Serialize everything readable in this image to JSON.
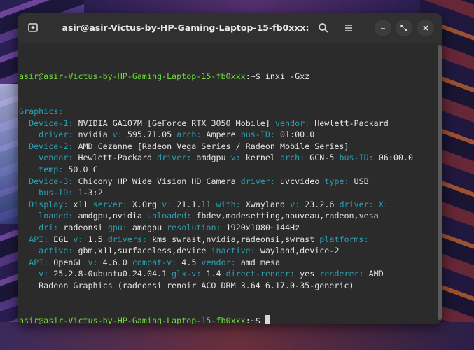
{
  "window": {
    "title": "asir@asir-Victus-by-HP-Gaming-Laptop-15-fb0xxx: ~"
  },
  "icons": {
    "new_tab": "new-tab-icon",
    "search": "search-icon",
    "menu": "hamburger-menu-icon",
    "minimize": "minimize-icon",
    "maximize": "maximize-icon",
    "close": "close-icon"
  },
  "colors": {
    "prompt_user": "#6fdc3a",
    "key": "#2aa1b3",
    "value": "#e4e4e4",
    "background": "#2b2b2b"
  },
  "terminal": {
    "prompt_user": "asir@asir-Victus-by-HP-Gaming-Laptop-15-fb0xxx",
    "prompt_path": ":~$",
    "command": " inxi -Gxz",
    "output": [
      [
        {
          "t": "k",
          "s": "Graphics:"
        }
      ],
      [
        {
          "t": "v",
          "s": "  "
        },
        {
          "t": "k",
          "s": "Device-1:"
        },
        {
          "t": "v",
          "s": " NVIDIA GA107M [GeForce RTX 3050 Mobile] "
        },
        {
          "t": "k",
          "s": "vendor:"
        },
        {
          "t": "v",
          "s": " Hewlett-Packard"
        }
      ],
      [
        {
          "t": "v",
          "s": "    "
        },
        {
          "t": "k",
          "s": "driver:"
        },
        {
          "t": "v",
          "s": " nvidia "
        },
        {
          "t": "k",
          "s": "v:"
        },
        {
          "t": "v",
          "s": " 595.71.05 "
        },
        {
          "t": "k",
          "s": "arch:"
        },
        {
          "t": "v",
          "s": " Ampere "
        },
        {
          "t": "k",
          "s": "bus-ID:"
        },
        {
          "t": "v",
          "s": " 01:00.0"
        }
      ],
      [
        {
          "t": "v",
          "s": "  "
        },
        {
          "t": "k",
          "s": "Device-2:"
        },
        {
          "t": "v",
          "s": " AMD Cezanne [Radeon Vega Series / Radeon Mobile Series]"
        }
      ],
      [
        {
          "t": "v",
          "s": "    "
        },
        {
          "t": "k",
          "s": "vendor:"
        },
        {
          "t": "v",
          "s": " Hewlett-Packard "
        },
        {
          "t": "k",
          "s": "driver:"
        },
        {
          "t": "v",
          "s": " amdgpu "
        },
        {
          "t": "k",
          "s": "v:"
        },
        {
          "t": "v",
          "s": " kernel "
        },
        {
          "t": "k",
          "s": "arch:"
        },
        {
          "t": "v",
          "s": " GCN-5 "
        },
        {
          "t": "k",
          "s": "bus-ID:"
        },
        {
          "t": "v",
          "s": " 06:00.0"
        }
      ],
      [
        {
          "t": "v",
          "s": "    "
        },
        {
          "t": "k",
          "s": "temp:"
        },
        {
          "t": "v",
          "s": " 50.0 C"
        }
      ],
      [
        {
          "t": "v",
          "s": "  "
        },
        {
          "t": "k",
          "s": "Device-3:"
        },
        {
          "t": "v",
          "s": " Chicony HP Wide Vision HD Camera "
        },
        {
          "t": "k",
          "s": "driver:"
        },
        {
          "t": "v",
          "s": " uvcvideo "
        },
        {
          "t": "k",
          "s": "type:"
        },
        {
          "t": "v",
          "s": " USB"
        }
      ],
      [
        {
          "t": "v",
          "s": "    "
        },
        {
          "t": "k",
          "s": "bus-ID:"
        },
        {
          "t": "v",
          "s": " 1-3:2"
        }
      ],
      [
        {
          "t": "v",
          "s": "  "
        },
        {
          "t": "k",
          "s": "Display:"
        },
        {
          "t": "v",
          "s": " x11 "
        },
        {
          "t": "k",
          "s": "server:"
        },
        {
          "t": "v",
          "s": " X.Org "
        },
        {
          "t": "k",
          "s": "v:"
        },
        {
          "t": "v",
          "s": " 21.1.11 "
        },
        {
          "t": "k",
          "s": "with:"
        },
        {
          "t": "v",
          "s": " Xwayland "
        },
        {
          "t": "k",
          "s": "v:"
        },
        {
          "t": "v",
          "s": " 23.2.6 "
        },
        {
          "t": "k",
          "s": "driver:"
        },
        {
          "t": "v",
          "s": " "
        },
        {
          "t": "k",
          "s": "X:"
        }
      ],
      [
        {
          "t": "v",
          "s": "    "
        },
        {
          "t": "k",
          "s": "loaded:"
        },
        {
          "t": "v",
          "s": " amdgpu,nvidia "
        },
        {
          "t": "k",
          "s": "unloaded:"
        },
        {
          "t": "v",
          "s": " fbdev,modesetting,nouveau,radeon,vesa"
        }
      ],
      [
        {
          "t": "v",
          "s": "    "
        },
        {
          "t": "k",
          "s": "dri:"
        },
        {
          "t": "v",
          "s": " radeonsi "
        },
        {
          "t": "k",
          "s": "gpu:"
        },
        {
          "t": "v",
          "s": " amdgpu "
        },
        {
          "t": "k",
          "s": "resolution:"
        },
        {
          "t": "v",
          "s": " 1920x1080~144Hz"
        }
      ],
      [
        {
          "t": "v",
          "s": "  "
        },
        {
          "t": "k",
          "s": "API:"
        },
        {
          "t": "v",
          "s": " EGL "
        },
        {
          "t": "k",
          "s": "v:"
        },
        {
          "t": "v",
          "s": " 1.5 "
        },
        {
          "t": "k",
          "s": "drivers:"
        },
        {
          "t": "v",
          "s": " kms_swrast,nvidia,radeonsi,swrast "
        },
        {
          "t": "k",
          "s": "platforms:"
        }
      ],
      [
        {
          "t": "v",
          "s": "    "
        },
        {
          "t": "k",
          "s": "active:"
        },
        {
          "t": "v",
          "s": " gbm,x11,surfaceless,device "
        },
        {
          "t": "k",
          "s": "inactive:"
        },
        {
          "t": "v",
          "s": " wayland,device-2"
        }
      ],
      [
        {
          "t": "v",
          "s": "  "
        },
        {
          "t": "k",
          "s": "API:"
        },
        {
          "t": "v",
          "s": " OpenGL "
        },
        {
          "t": "k",
          "s": "v:"
        },
        {
          "t": "v",
          "s": " 4.6.0 "
        },
        {
          "t": "k",
          "s": "compat-v:"
        },
        {
          "t": "v",
          "s": " 4.5 "
        },
        {
          "t": "k",
          "s": "vendor:"
        },
        {
          "t": "v",
          "s": " amd mesa"
        }
      ],
      [
        {
          "t": "v",
          "s": "    "
        },
        {
          "t": "k",
          "s": "v:"
        },
        {
          "t": "v",
          "s": " 25.2.8-0ubuntu0.24.04.1 "
        },
        {
          "t": "k",
          "s": "glx-v:"
        },
        {
          "t": "v",
          "s": " 1.4 "
        },
        {
          "t": "k",
          "s": "direct-render:"
        },
        {
          "t": "v",
          "s": " yes "
        },
        {
          "t": "k",
          "s": "renderer:"
        },
        {
          "t": "v",
          "s": " AMD"
        }
      ],
      [
        {
          "t": "v",
          "s": "    Radeon Graphics (radeonsi renoir ACO DRM 3.64 6.17.0-35-generic)"
        }
      ]
    ]
  }
}
